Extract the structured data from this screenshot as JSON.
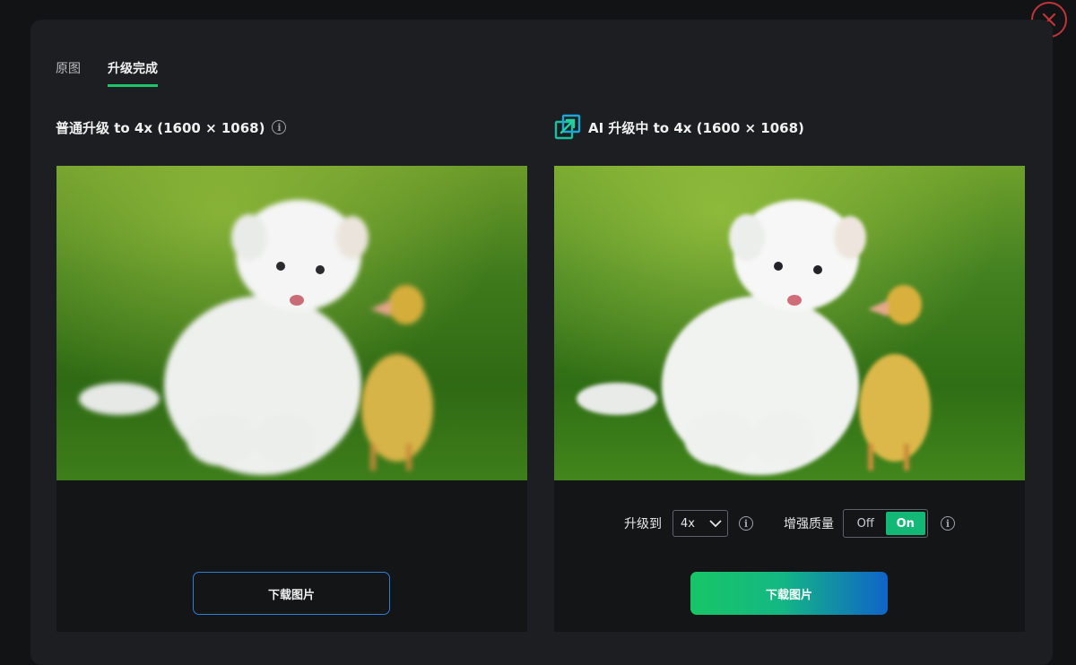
{
  "tabs": [
    {
      "label": "原图",
      "active": false
    },
    {
      "label": "升级完成",
      "active": true
    }
  ],
  "left_panel": {
    "title": "普通升级 to 4x (1600 × 1068)",
    "download_label": "下载图片"
  },
  "right_panel": {
    "title": "AI 升级中 to 4x (1600 × 1068)",
    "upscale_label": "升级到",
    "upscale_value": "4x",
    "enhance_label": "增强质量",
    "toggle_off": "Off",
    "toggle_on": "On",
    "enhance_state": "on",
    "download_label": "下载图片"
  },
  "icons": {
    "info": "i",
    "close": "close-icon",
    "ai": "ai-upscale-icon",
    "dropdown": "chevron-down-icon"
  },
  "colors": {
    "accent_green": "#1ec46b",
    "close_red": "#c0343b",
    "outline_blue": "#2a7fd8",
    "gradient_start": "#18c566",
    "gradient_end": "#1064c8"
  }
}
